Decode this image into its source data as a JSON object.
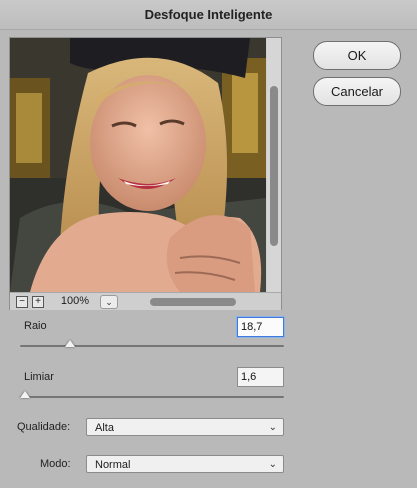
{
  "dialog": {
    "title": "Desfoque Inteligente"
  },
  "buttons": {
    "ok": "OK",
    "cancel": "Cancelar"
  },
  "preview": {
    "zoom_out_icon": "minus-icon",
    "zoom_in_icon": "plus-icon",
    "zoom_level": "100%",
    "zoom_dropdown_icon": "chevron-down-icon"
  },
  "radius": {
    "label": "Raio",
    "value": "18,7",
    "slider_fraction": 0.19
  },
  "threshold": {
    "label": "Limiar",
    "value": "1,6",
    "slider_fraction": 0.02
  },
  "quality": {
    "label": "Qualidade:",
    "selected": "Alta"
  },
  "mode": {
    "label": "Modo:",
    "selected": "Normal"
  },
  "colors": {
    "focus_ring": "#3e7bd6",
    "dialog_bg": "#b9b9b9"
  }
}
